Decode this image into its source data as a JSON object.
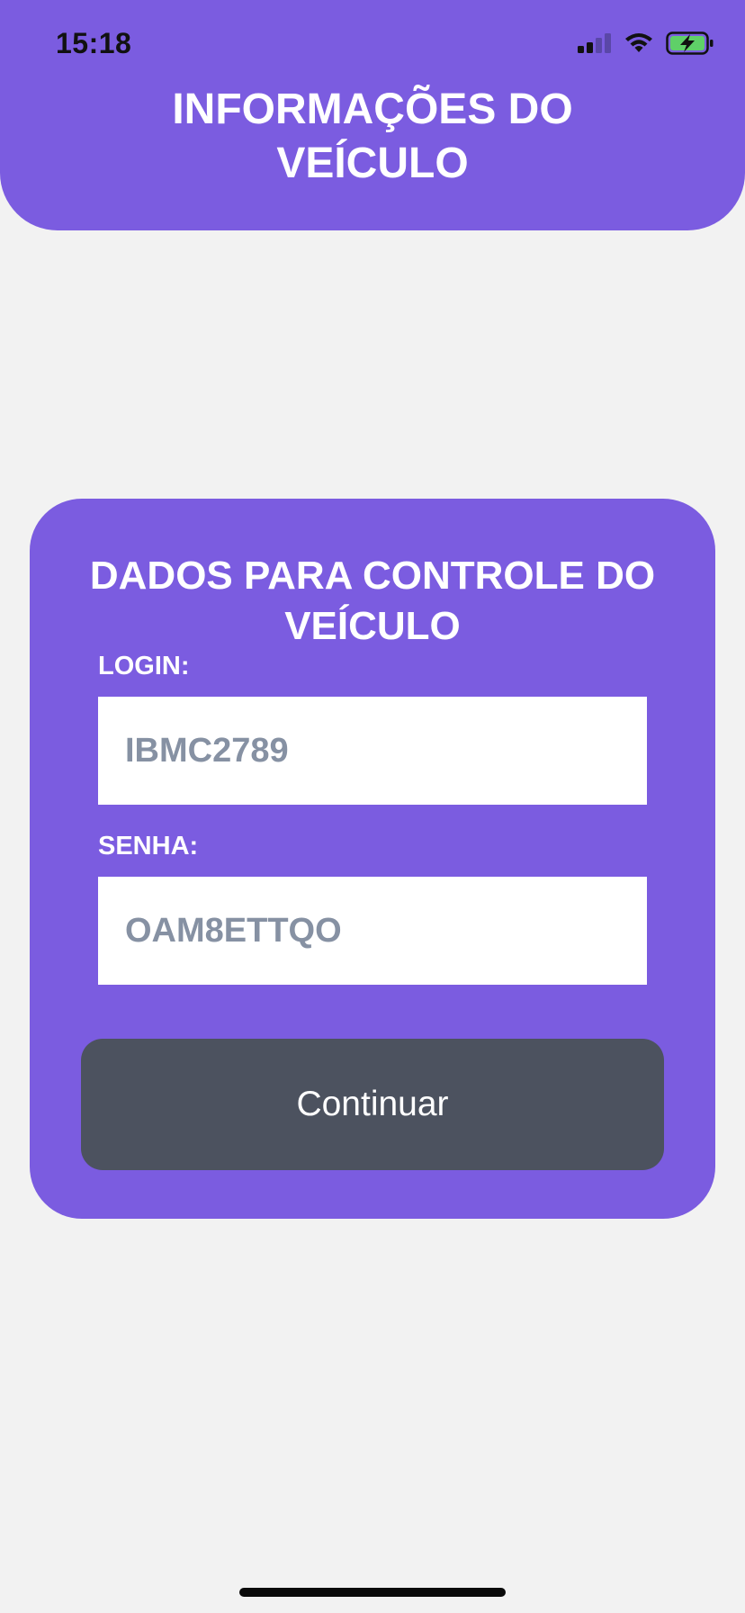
{
  "status_bar": {
    "time": "15:18",
    "icons": [
      "cellular-signal-icon",
      "wifi-icon",
      "battery-charging-icon"
    ]
  },
  "header": {
    "title": "INFORMAÇÕES DO\nVEÍCULO"
  },
  "card": {
    "title": "DADOS PARA CONTROLE DO\nVEÍCULO",
    "login_label": "LOGIN:",
    "login_value": "IBMC2789",
    "password_label": "SENHA:",
    "password_value": "OAM8ETTQO",
    "continue_label": "Continuar"
  },
  "colors": {
    "primary": "#7b5ce0",
    "button": "#4c525f",
    "background": "#f2f2f2",
    "input_text": "#8691a3",
    "battery_fill": "#5fd068"
  }
}
